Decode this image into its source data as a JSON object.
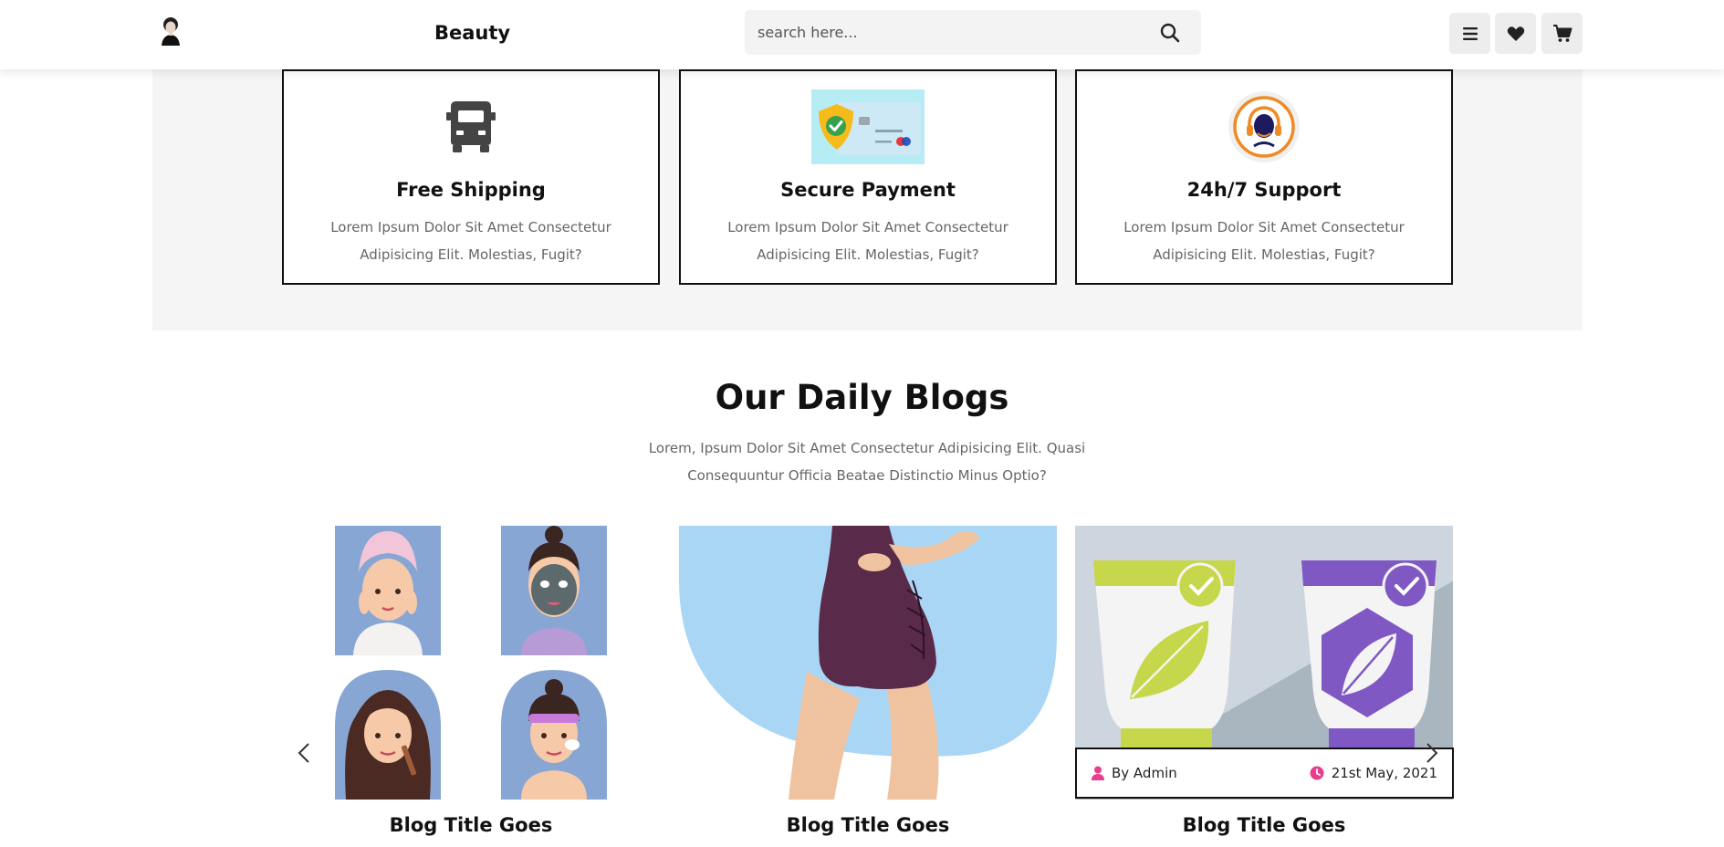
{
  "header": {
    "brand": "Beauty",
    "search_placeholder": "search here...",
    "icons": [
      "avatar-logo",
      "search-icon",
      "menu-icon",
      "heart-icon",
      "cart-icon"
    ]
  },
  "features": [
    {
      "title": "Free Shipping",
      "text": "Lorem Ipsum Dolor Sit Amet Consectetur Adipisicing Elit. Molestias, Fugit?",
      "icon": "truck-icon"
    },
    {
      "title": "Secure Payment",
      "text": "Lorem Ipsum Dolor Sit Amet Consectetur Adipisicing Elit. Molestias, Fugit?",
      "icon": "credit-card-icon"
    },
    {
      "title": "24h/7 Support",
      "text": "Lorem Ipsum Dolor Sit Amet Consectetur Adipisicing Elit. Molestias, Fugit?",
      "icon": "headset-icon"
    }
  ],
  "blogs": {
    "title": "Our Daily Blogs",
    "subtitle": "Lorem, Ipsum Dolor Sit Amet Consectetur Adipisicing Elit. Quasi Consequuntur Officia Beatae Distinctio Minus Optio?",
    "cards": [
      {
        "title": "Blog Title Goes"
      },
      {
        "title": "Blog Title Goes"
      },
      {
        "title": "Blog Title Goes",
        "author": "By Admin",
        "date": "21st May, 2021"
      }
    ]
  },
  "colors": {
    "accent": "#e83e8c",
    "border": "#111111",
    "section_bg": "#f5f5f5"
  }
}
